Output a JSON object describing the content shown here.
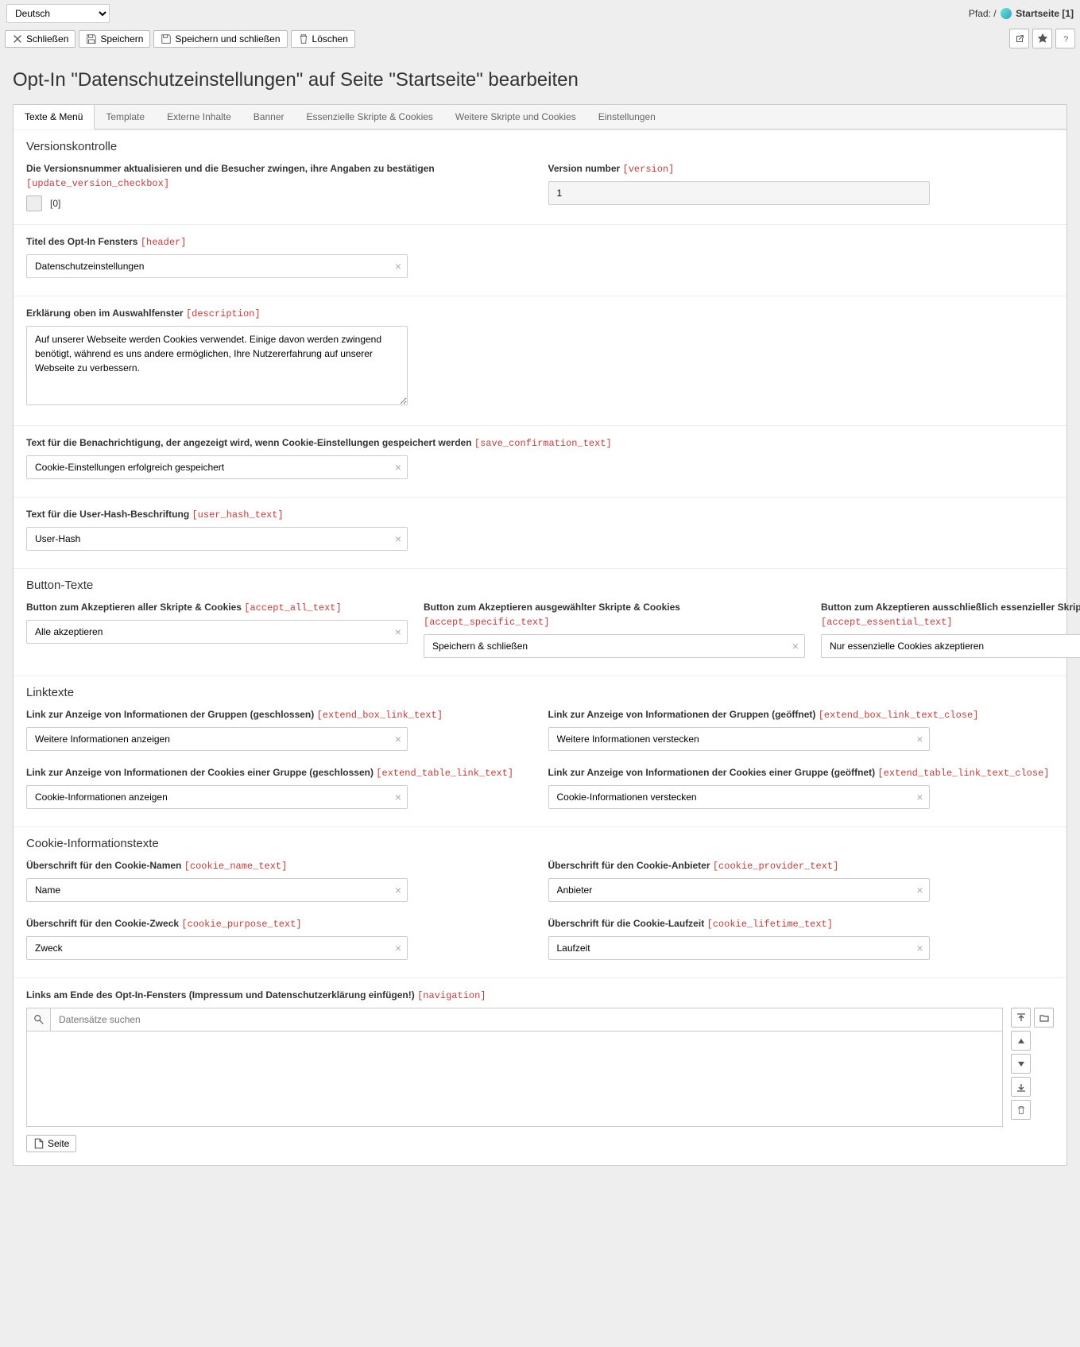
{
  "lang": "Deutsch",
  "path_prefix": "Pfad: / ",
  "path_page": "Startseite [1]",
  "toolbar": {
    "close": "Schließen",
    "save": "Speichern",
    "save_close": "Speichern und schließen",
    "delete": "Löschen"
  },
  "page_title": "Opt-In \"Datenschutzeinstellungen\" auf Seite \"Startseite\" bearbeiten",
  "tabs": [
    "Texte & Menü",
    "Template",
    "Externe Inhalte",
    "Banner",
    "Essenzielle Skripte & Cookies",
    "Weitere Skripte und Cookies",
    "Einstellungen"
  ],
  "versionskontrolle": {
    "heading": "Versionskontrolle",
    "update_label": "Die Versionsnummer aktualisieren und die Besucher zwingen, ihre Angaben zu bestätigen ",
    "update_key": "[update_version_checkbox]",
    "checkbox_val": "[0]",
    "number_label": "Version number ",
    "number_key": "[version]",
    "number_value": "1"
  },
  "header_field": {
    "label": "Titel des Opt-In Fensters ",
    "key": "[header]",
    "value": "Datenschutzeinstellungen"
  },
  "description_field": {
    "label": "Erklärung oben im Auswahlfenster ",
    "key": "[description]",
    "value": "Auf unserer Webseite werden Cookies verwendet. Einige davon werden zwingend benötigt, während es uns andere ermöglichen, Ihre Nutzererfahrung auf unserer Webseite zu verbessern."
  },
  "save_conf": {
    "label": "Text für die Benachrichtigung, der angezeigt wird, wenn Cookie-Einstellungen gespeichert werden ",
    "key": "[save_confirmation_text]",
    "value": "Cookie-Einstellungen erfolgreich gespeichert"
  },
  "user_hash": {
    "label": "Text für die User-Hash-Beschriftung ",
    "key": "[user_hash_text]",
    "value": "User-Hash"
  },
  "button_texte": {
    "heading": "Button-Texte",
    "accept_all": {
      "label": "Button zum Akzeptieren aller Skripte & Cookies ",
      "key": "[accept_all_text]",
      "value": "Alle akzeptieren"
    },
    "accept_specific": {
      "label": "Button zum Akzeptieren ausgewählter Skripte & Cookies ",
      "key": "[accept_specific_text]",
      "value": "Speichern & schließen"
    },
    "accept_essential": {
      "label": "Button zum Akzeptieren ausschließlich essenzieller Skripte & Cookies ",
      "key": "[accept_essential_text]",
      "value": "Nur essenzielle Cookies akzeptieren"
    }
  },
  "linktexte": {
    "heading": "Linktexte",
    "extend_box": {
      "label": "Link zur Anzeige von Informationen der Gruppen (geschlossen) ",
      "key": "[extend_box_link_text]",
      "value": "Weitere Informationen anzeigen"
    },
    "extend_box_close": {
      "label": "Link zur Anzeige von Informationen der Gruppen (geöffnet) ",
      "key": "[extend_box_link_text_close]",
      "value": "Weitere Informationen verstecken"
    },
    "extend_table": {
      "label": "Link zur Anzeige von Informationen der Cookies einer Gruppe (geschlossen) ",
      "key": "[extend_table_link_text]",
      "value": "Cookie-Informationen anzeigen"
    },
    "extend_table_close": {
      "label": "Link zur Anzeige von Informationen der Cookies einer Gruppe (geöffnet) ",
      "key": "[extend_table_link_text_close]",
      "value": "Cookie-Informationen verstecken"
    }
  },
  "cookie_info": {
    "heading": "Cookie-Informationstexte",
    "name": {
      "label": "Überschrift für den Cookie-Namen ",
      "key": "[cookie_name_text]",
      "value": "Name"
    },
    "provider": {
      "label": "Überschrift für den Cookie-Anbieter ",
      "key": "[cookie_provider_text]",
      "value": "Anbieter"
    },
    "purpose": {
      "label": "Überschrift für den Cookie-Zweck ",
      "key": "[cookie_purpose_text]",
      "value": "Zweck"
    },
    "lifetime": {
      "label": "Überschrift für die Cookie-Laufzeit ",
      "key": "[cookie_lifetime_text]",
      "value": "Laufzeit"
    }
  },
  "navigation": {
    "label": "Links am Ende des Opt-In-Fensters (Impressum und Datenschutzerklärung einfügen!) ",
    "key": "[navigation]",
    "search_placeholder": "Datensätze suchen",
    "page_btn": "Seite"
  }
}
